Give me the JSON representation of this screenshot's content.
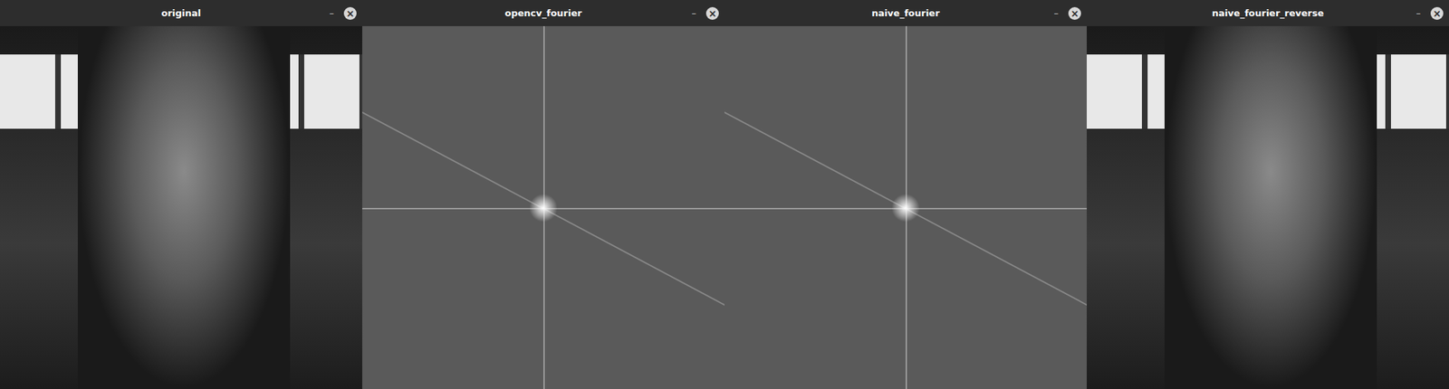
{
  "windows": [
    {
      "title": "original",
      "kind": "photo",
      "minimize": "–",
      "close": "×"
    },
    {
      "title": "opencv_fourier",
      "kind": "spectrum",
      "minimize": "–",
      "close": "×"
    },
    {
      "title": "naive_fourier",
      "kind": "spectrum",
      "minimize": "–",
      "close": "×"
    },
    {
      "title": "naive_fourier_reverse",
      "kind": "photo",
      "minimize": "–",
      "close": "×"
    }
  ]
}
